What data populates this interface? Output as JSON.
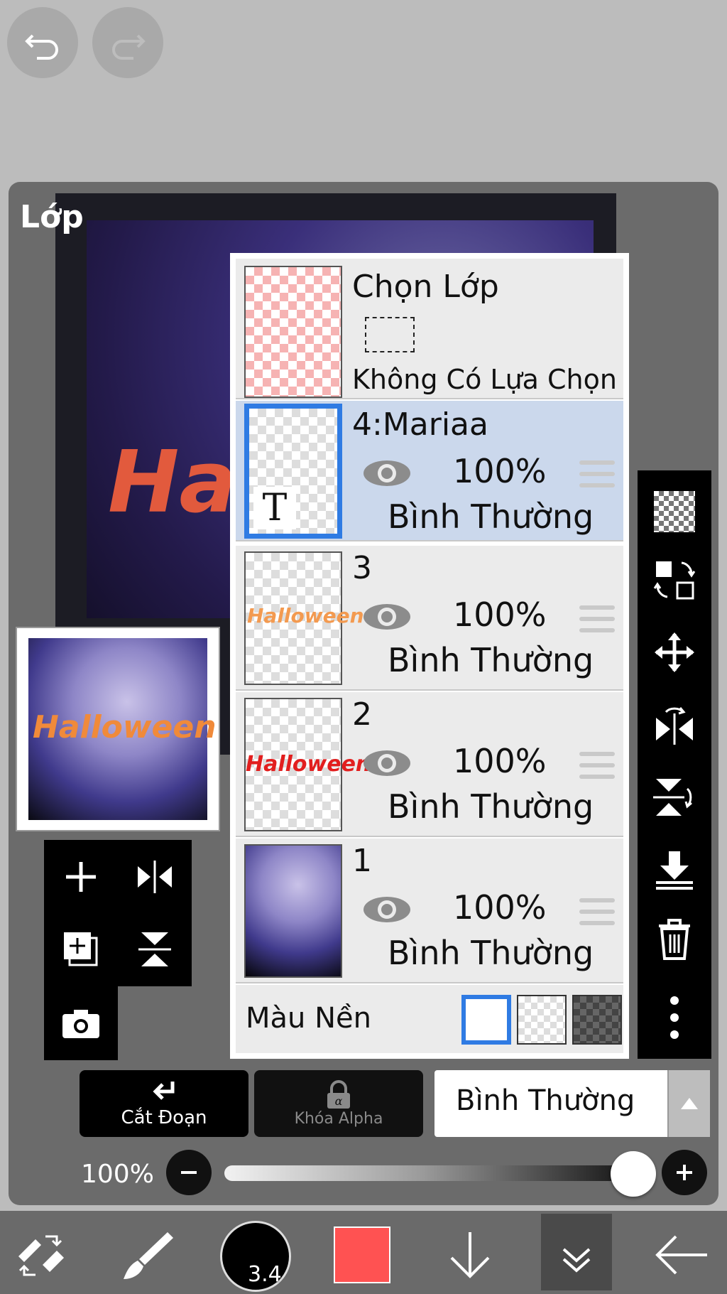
{
  "panel": {
    "title": "Lớp"
  },
  "selection_row": {
    "title": "Chọn Lớp",
    "subtitle": "Không Có Lựa Chọn"
  },
  "layers": [
    {
      "name": "4:Mariaa",
      "opacity": "100%",
      "mode": "Bình Thường",
      "selected": true,
      "thumb_label": "T"
    },
    {
      "name": "3",
      "opacity": "100%",
      "mode": "Bình Thường",
      "selected": false
    },
    {
      "name": "2",
      "opacity": "100%",
      "mode": "Bình Thường",
      "selected": false
    },
    {
      "name": "1",
      "opacity": "100%",
      "mode": "Bình Thường",
      "selected": false
    }
  ],
  "background": {
    "label": "Màu Nền",
    "options": [
      "white",
      "transparent",
      "dark-checker"
    ],
    "selected": "white"
  },
  "clipping": {
    "label": "Cắt Đoạn"
  },
  "alpha_lock": {
    "label": "Khóa Alpha"
  },
  "blend_mode": {
    "value": "Bình Thường"
  },
  "opacity": {
    "label": "100%",
    "value": 1.0
  },
  "toolbar": {
    "brush_size": "3.4",
    "color": "#ff5252"
  },
  "colors": {
    "selected_row": "#cbd8ec",
    "accent": "#2f7be3"
  },
  "right_tools": [
    "checker-icon",
    "swap-layer-icon",
    "move-icon",
    "flip-horizontal-icon",
    "flip-vertical-icon",
    "merge-down-icon",
    "trash-icon",
    "more-icon"
  ],
  "left_tools": [
    "add-layer-icon",
    "flip-h-icon",
    "duplicate-layer-icon",
    "flip-v-icon",
    "camera-icon"
  ]
}
